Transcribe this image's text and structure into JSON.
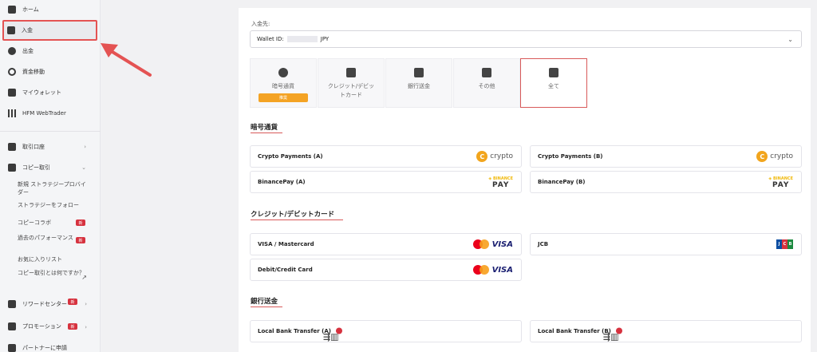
{
  "sidebar": {
    "items": [
      {
        "label": "ホーム"
      },
      {
        "label": "入金"
      },
      {
        "label": "出金"
      },
      {
        "label": "資金移動"
      },
      {
        "label": "マイウォレット"
      },
      {
        "label": "HFM WebTrader"
      },
      {
        "label": "取引口座"
      },
      {
        "label": "コピー取引"
      }
    ],
    "copy_sub": [
      {
        "label": "新規 ストラテジープロバイダー"
      },
      {
        "label": "ストラテジーをフォロー"
      },
      {
        "label": "コピーコラボ",
        "badge": "新"
      },
      {
        "label": "過去のパフォーマンス",
        "badge": "新"
      },
      {
        "label": "お気に入りリスト"
      },
      {
        "label": "コピー取引とは何ですか？"
      }
    ],
    "bottom": [
      {
        "label": "リワードセンター",
        "badge": "新"
      },
      {
        "label": "プロモーション",
        "badge": "新"
      },
      {
        "label": "パートナーに申請"
      }
    ]
  },
  "deposit": {
    "dest_label": "入金先:",
    "wallet_prefix": "Wallet ID:",
    "wallet_currency": "JPY",
    "tabs": [
      {
        "label": "暗号通貨",
        "recommend": "推奨"
      },
      {
        "label": "クレジット/デビットカード"
      },
      {
        "label": "銀行送金"
      },
      {
        "label": "その他"
      },
      {
        "label": "全て"
      }
    ],
    "sections": {
      "crypto": {
        "title": "暗号通貨",
        "cards": [
          "Crypto Payments (A)",
          "Crypto Payments (B)",
          "BinancePay (A)",
          "BinancePay (B)"
        ]
      },
      "card": {
        "title": "クレジット/デビットカード",
        "cards": [
          "VISA / Mastercard",
          "JCB",
          "Debit/Credit Card"
        ]
      },
      "bank": {
        "title": "銀行送金",
        "cards": [
          "Local Bank Transfer (A)",
          "Local Bank Transfer (B)"
        ]
      }
    },
    "logos": {
      "crypto_text": "crypto",
      "binance_top": "◈ BINANCE",
      "binance_bottom": "PAY",
      "visa": "VISA",
      "jcb": [
        "J",
        "C",
        "B"
      ]
    }
  },
  "colors": {
    "accent_red": "#d85a5a",
    "recommend_orange": "#f4a324",
    "badge_red": "#d6323f"
  }
}
